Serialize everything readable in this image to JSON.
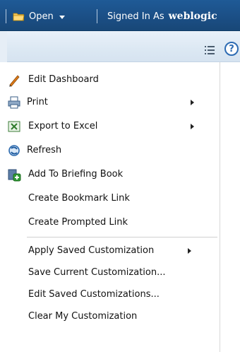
{
  "header": {
    "open_label": "Open",
    "signed_in_prefix": "Signed In As",
    "username": "weblogic"
  },
  "toolbar": {
    "list_icon": "list-icon",
    "help_icon": "help-icon"
  },
  "menu": {
    "items": [
      {
        "label": "Edit Dashboard",
        "icon": "pencil-icon"
      },
      {
        "label": "Print",
        "icon": "printer-icon",
        "submenu": true
      },
      {
        "label": "Export to Excel",
        "icon": "excel-icon",
        "submenu": true
      },
      {
        "label": "Refresh",
        "icon": "refresh-icon"
      },
      {
        "label": "Add To Briefing Book",
        "icon": "add-briefing-book-icon"
      },
      {
        "label": "Create Bookmark Link"
      },
      {
        "label": "Create Prompted Link"
      },
      {
        "label": "Apply Saved Customization",
        "submenu": true
      },
      {
        "label": "Save Current Customization..."
      },
      {
        "label": "Edit Saved Customizations..."
      },
      {
        "label": "Clear My Customization"
      }
    ]
  },
  "colors": {
    "header_blue": "#1b4f86",
    "subbar_light": "#dce8f3",
    "text": "#111111"
  }
}
